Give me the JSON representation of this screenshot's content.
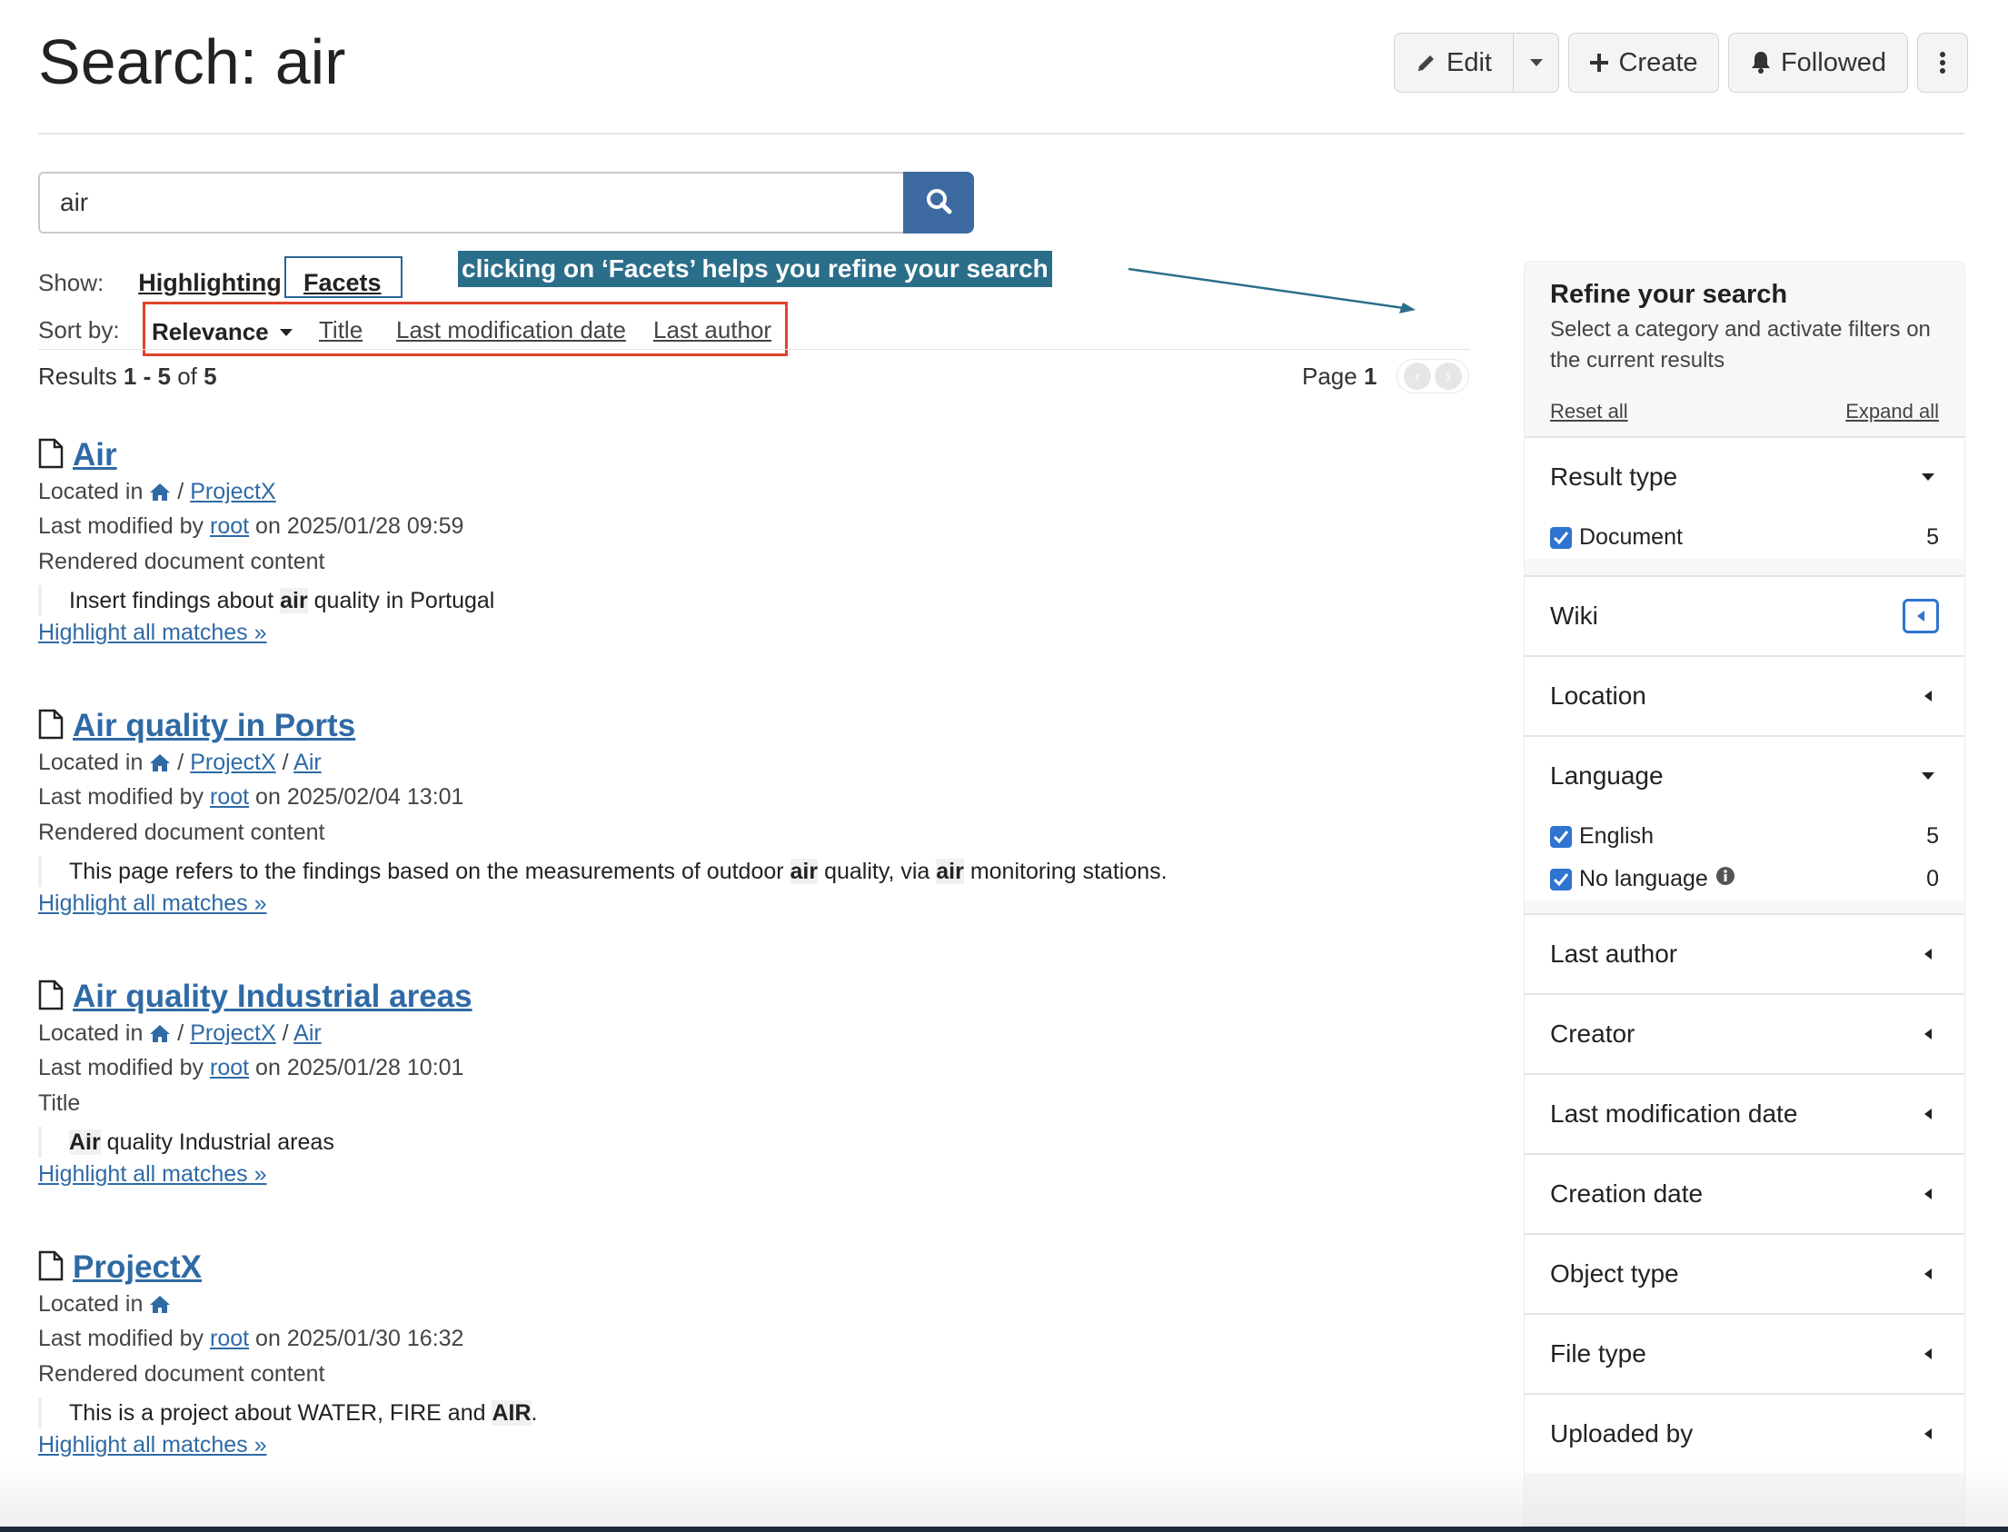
{
  "header": {
    "title": "Search: air",
    "edit_label": "Edit",
    "create_label": "Create",
    "followed_label": "Followed"
  },
  "search": {
    "value": "air"
  },
  "show": {
    "label": "Show:",
    "highlighting": "Highlighting",
    "facets": "Facets"
  },
  "annotation": "clicking on ‘Facets’ helps you refine your search",
  "sort": {
    "label": "Sort by:",
    "relevance": "Relevance",
    "title": "Title",
    "last_mod": "Last modification date",
    "last_author": "Last author"
  },
  "results_info": {
    "prefix": "Results ",
    "from": "1",
    "dash": " - ",
    "to": "5",
    "of": " of ",
    "total": "5",
    "page_label": "Page ",
    "page": "1"
  },
  "common": {
    "located_in": "Located in",
    "last_modified_by": "Last modified by",
    "on": "on",
    "highlight_all": "Highlight all matches »",
    "slash": "/"
  },
  "results": [
    {
      "title": "Air",
      "loc1": "ProjectX",
      "loc2": "",
      "author": "root",
      "date": "2025/01/28 09:59",
      "section": "Rendered document content",
      "snip_a": "Insert findings about ",
      "snip_b": "air",
      "snip_c": " quality in Portugal",
      "snip_d": "",
      "snip_e": ""
    },
    {
      "title": "Air quality in Ports",
      "loc1": "ProjectX",
      "loc2": "Air",
      "author": "root",
      "date": "2025/02/04 13:01",
      "section": "Rendered document content",
      "snip_a": "This page refers to the findings based on the measurements of outdoor ",
      "snip_b": "air",
      "snip_c": " quality, via ",
      "snip_d": "air",
      "snip_e": " monitoring stations."
    },
    {
      "title": "Air quality Industrial areas",
      "loc1": "ProjectX",
      "loc2": "Air",
      "author": "root",
      "date": "2025/01/28 10:01",
      "section": "Title",
      "snip_a": "",
      "snip_b": "Air",
      "snip_c": " quality Industrial areas",
      "snip_d": "",
      "snip_e": ""
    },
    {
      "title": "ProjectX",
      "loc1": "",
      "loc2": "",
      "author": "root",
      "date": "2025/01/30 16:32",
      "section": "Rendered document content",
      "snip_a": "This is a project about WATER, FIRE and ",
      "snip_b": "AIR",
      "snip_c": ".",
      "snip_d": "",
      "snip_e": ""
    }
  ],
  "panel": {
    "title": "Refine your search",
    "desc": "Select a category and activate filters on the current results",
    "reset_all": "Reset all",
    "expand_all": "Expand all",
    "facets": {
      "result_type": "Result type",
      "document": "Document",
      "document_count": "5",
      "wiki": "Wiki",
      "location": "Location",
      "language": "Language",
      "english": "English",
      "english_count": "5",
      "no_language": "No language",
      "no_language_count": "0",
      "last_author": "Last author",
      "creator": "Creator",
      "last_mod_date": "Last modification date",
      "creation_date": "Creation date",
      "object_type": "Object type",
      "file_type": "File type",
      "uploaded_by": "Uploaded by"
    }
  },
  "colors": {
    "accent": "#3d6aa0",
    "link": "#2f6aa5",
    "annotation_bg": "#2b6e8a",
    "annotation_box": "#e0432c",
    "checkbox": "#2f74d0"
  },
  "icons": [
    "pencil-icon",
    "caret-down-icon",
    "plus-icon",
    "bell-icon",
    "kebab-icon",
    "search-icon",
    "file-icon",
    "home-icon",
    "info-icon",
    "caret-left-icon",
    "check-icon"
  ]
}
